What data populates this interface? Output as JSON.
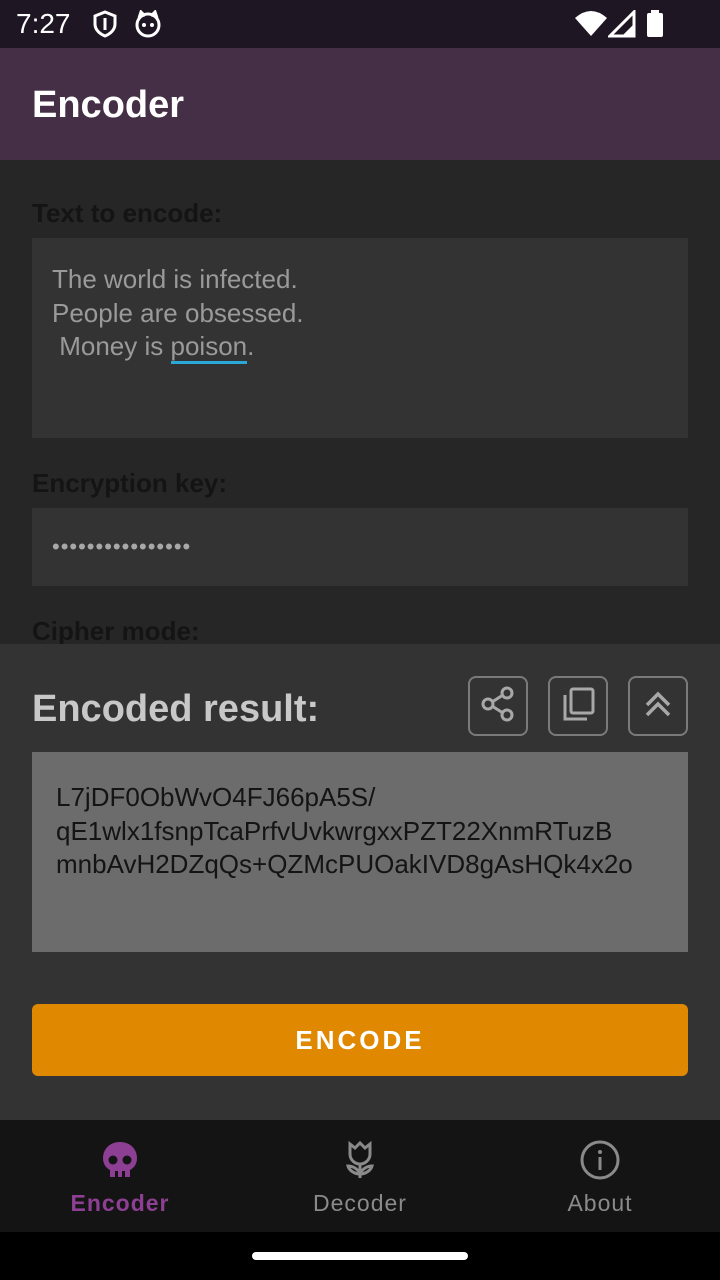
{
  "status_bar": {
    "time": "7:27"
  },
  "app_bar": {
    "title": "Encoder"
  },
  "form": {
    "text_label": "Text to encode:",
    "text_lines": [
      "The world is infected.",
      "People are obsessed.",
      " Money is "
    ],
    "underlined_word": "poison",
    "trailing": ".",
    "key_label": "Encryption key:",
    "key_value": "••••••••••••••••",
    "cipher_label": "Cipher mode:"
  },
  "sheet": {
    "title": "Encoded result:",
    "result_lines": [
      "L7jDF0ObWvO4FJ66pA5S/",
      "qE1wlx1fsnpTcaPrfvUvkwrgxxPZT22XnmRTuzB",
      "mnbAvH2DZqQs+QZMcPUOakIVD8gAsHQk4x2o"
    ],
    "encode_label": "ENCODE"
  },
  "nav": {
    "items": [
      {
        "label": "Encoder",
        "icon": "skull-icon",
        "active": true
      },
      {
        "label": "Decoder",
        "icon": "flower-icon",
        "active": false
      },
      {
        "label": "About",
        "icon": "info-icon",
        "active": false
      }
    ]
  },
  "colors": {
    "accent": "#df8800",
    "app_bar": "#442f46",
    "nav_active": "#8d3f93",
    "nav_inactive": "#8a8a8a"
  }
}
